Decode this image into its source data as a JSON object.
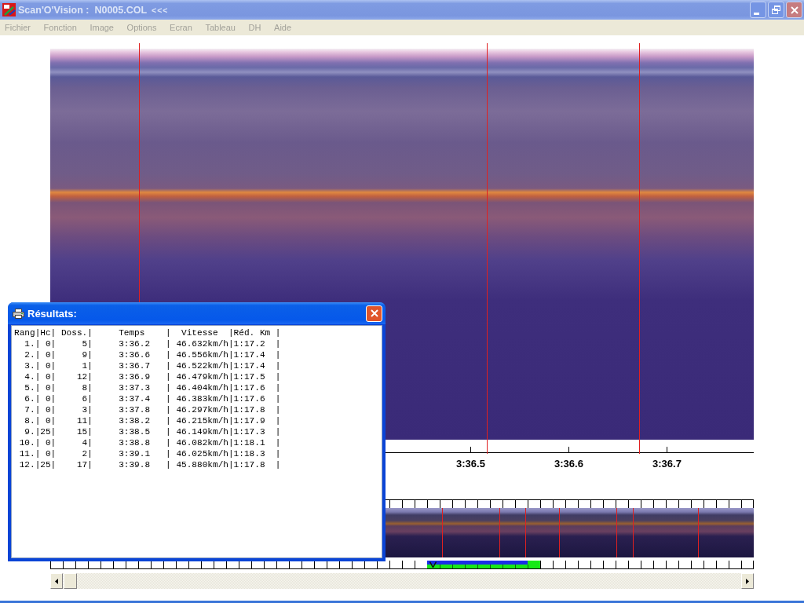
{
  "window": {
    "title": "Scan'O'Vision :  N0005.COL",
    "title_mark": "<<<",
    "active": false
  },
  "menu": [
    {
      "label": "Fichier",
      "disabled": true
    },
    {
      "label": "Fonction",
      "disabled": true
    },
    {
      "label": "Image",
      "disabled": true
    },
    {
      "label": "Options",
      "disabled": true
    },
    {
      "label": "Ecran",
      "disabled": true
    },
    {
      "label": "Tableau",
      "disabled": true
    },
    {
      "label": "DH",
      "disabled": true
    },
    {
      "label": "Aide",
      "disabled": true
    }
  ],
  "time_axis": {
    "labels": [
      "3:36.5",
      "3:36.6",
      "3:36.7"
    ]
  },
  "results": {
    "title": "Résultats:",
    "active": true,
    "header": "Rang|Hc| Doss.|     Temps    |  Vitesse  |Réd. Km |",
    "lines": [
      "  1.| 0|     5|     3:36.2   | 46.632km/h|1:17.2  |",
      "  2.| 0|     9|     3:36.6   | 46.556km/h|1:17.4  |",
      "  3.| 0|     1|     3:36.7   | 46.522km/h|1:17.4  |",
      "  4.| 0|    12|     3:36.9   | 46.479km/h|1:17.5  |",
      "  5.| 0|     8|     3:37.3   | 46.404km/h|1:17.6  |",
      "  6.| 0|     6|     3:37.4   | 46.383km/h|1:17.6  |",
      "  7.| 0|     3|     3:37.8   | 46.297km/h|1:17.8  |",
      "  8.| 0|    11|     3:38.2   | 46.215km/h|1:17.9  |",
      "  9.|25|    15|     3:38.5   | 46.149km/h|1:17.3  |",
      " 10.| 0|     4|     3:38.8   | 46.082km/h|1:18.1  |",
      " 11.| 0|     2|     3:39.1   | 46.025km/h|1:18.3  |",
      " 12.|25|    17|     3:39.8   | 45.880km/h|1:17.8  |"
    ]
  }
}
